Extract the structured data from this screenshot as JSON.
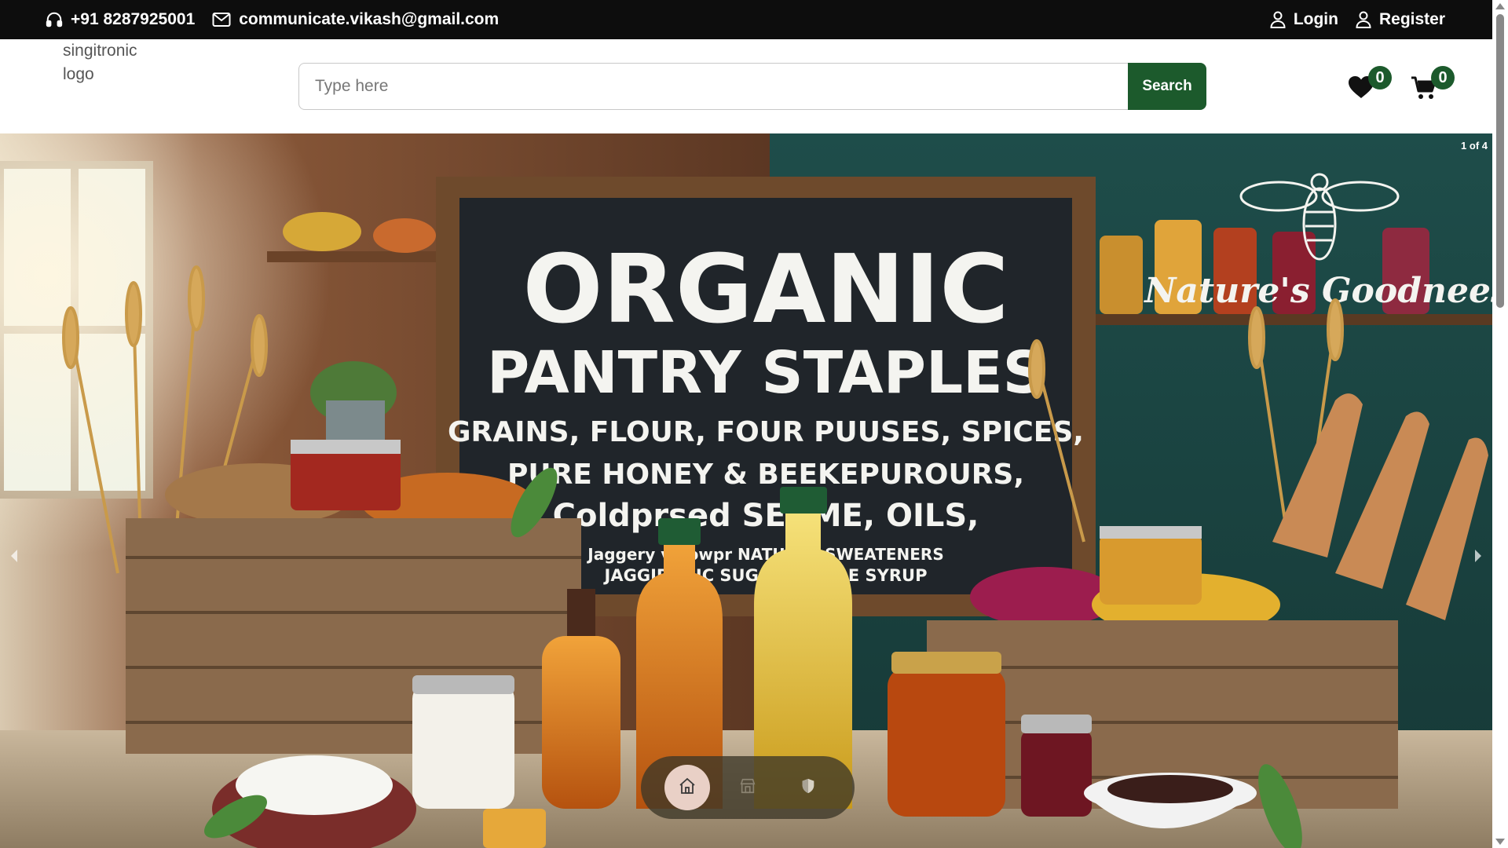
{
  "topbar": {
    "phone": "+91 8287925001",
    "email": "communicate.vikash@gmail.com",
    "login_label": "Login",
    "register_label": "Register"
  },
  "header": {
    "logo_alt": "singitronic logo",
    "search": {
      "placeholder": "Type here",
      "value": "",
      "button_label": "Search"
    },
    "wishlist_count": "0",
    "cart_count": "0"
  },
  "hero": {
    "counter": "1 of 4",
    "banner": {
      "heading_line1": "ORGANIC",
      "heading_line2": "PANTRY STAPLES",
      "line3": "GRAINS, FLOUR, FOUR PUUSES, SPICES,",
      "line4": "PURE HONEY & BEEKEPUROURS,",
      "line5": "Coldprsed SEAME, OILS,",
      "line6": "Jaggery v Sowpr  NATURAL SWEATENERS",
      "line7": "JAGGIRANIC SUGAR, MAPLE SYRUP",
      "brand": "Nature's Goodnees"
    },
    "bottom_nav": [
      "home-icon",
      "store-icon",
      "shield-icon"
    ]
  },
  "colors": {
    "topbar_bg": "#0d0d0d",
    "brand_green": "#1c5a2c",
    "chalkboard": "#20252a"
  }
}
